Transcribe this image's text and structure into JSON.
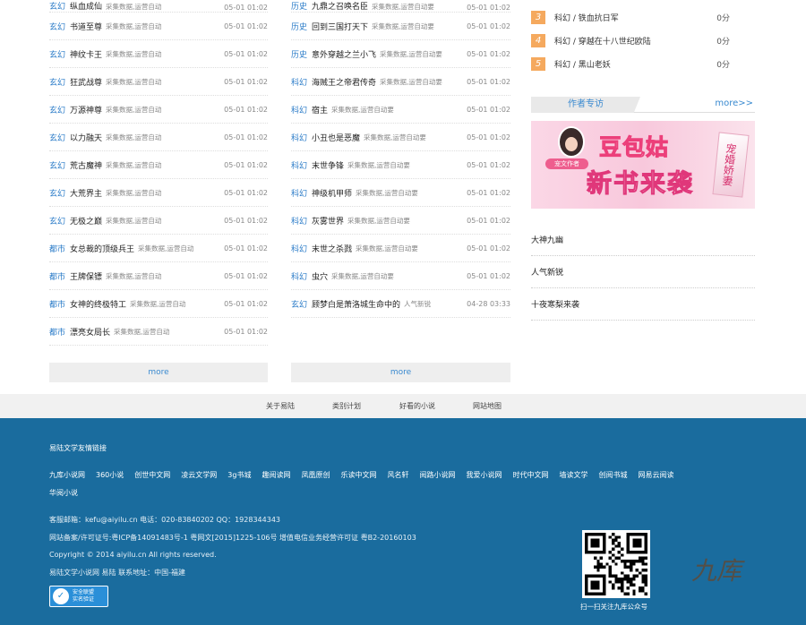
{
  "col_a": {
    "first_row": {
      "cat": "玄幻",
      "title": "纵血成仙",
      "sub": "采集数据,运营自动",
      "date": "05-01 01:02"
    },
    "rows": [
      {
        "cat": "玄幻",
        "title": "书道至尊",
        "sub": "采集数据,运营自动",
        "date": "05-01 01:02"
      },
      {
        "cat": "玄幻",
        "title": "神纹卡王",
        "sub": "采集数据,运营自动",
        "date": "05-01 01:02"
      },
      {
        "cat": "玄幻",
        "title": "狂武战尊",
        "sub": "采集数据,运营自动",
        "date": "05-01 01:02"
      },
      {
        "cat": "玄幻",
        "title": "万源神尊",
        "sub": "采集数据,运营自动",
        "date": "05-01 01:02"
      },
      {
        "cat": "玄幻",
        "title": "以力融天",
        "sub": "采集数据,运营自动",
        "date": "05-01 01:02"
      },
      {
        "cat": "玄幻",
        "title": "荒古魔神",
        "sub": "采集数据,运营自动",
        "date": "05-01 01:02"
      },
      {
        "cat": "玄幻",
        "title": "大荒界主",
        "sub": "采集数据,运营自动",
        "date": "05-01 01:02"
      },
      {
        "cat": "玄幻",
        "title": "无极之巅",
        "sub": "采集数据,运营自动",
        "date": "05-01 01:02"
      },
      {
        "cat": "都市",
        "title": "女总裁的顶级兵王",
        "sub": "采集数据,运营自动",
        "date": "05-01 01:02"
      },
      {
        "cat": "都市",
        "title": "王牌保镖",
        "sub": "采集数据,运营自动",
        "date": "05-01 01:02"
      },
      {
        "cat": "都市",
        "title": "女神的终极特工",
        "sub": "采集数据,运营自动",
        "date": "05-01 01:02"
      },
      {
        "cat": "都市",
        "title": "漂亮女局长",
        "sub": "采集数据,运营自动",
        "date": "05-01 01:02"
      }
    ],
    "more": "more"
  },
  "col_b": {
    "first_row": {
      "cat": "历史",
      "title": "九鼎之召唤名臣",
      "sub": "采集数据,运营自动要",
      "date": "05-01 01:02"
    },
    "rows": [
      {
        "cat": "历史",
        "title": "九鼎之召唤名臣",
        "sub": "采集数据,运营自动要",
        "date": "05-01 01:02"
      },
      {
        "cat": "历史",
        "title": "回到三国打天下",
        "sub": "采集数据,运营自动要",
        "date": "05-01 01:02"
      },
      {
        "cat": "历史",
        "title": "意外穿越之兰小飞",
        "sub": "采集数据,运营自动要",
        "date": "05-01 01:02"
      },
      {
        "cat": "科幻",
        "title": "海贼王之帝君传奇",
        "sub": "采集数据,运营自动要",
        "date": "05-01 01:02"
      },
      {
        "cat": "科幻",
        "title": "宿主",
        "sub": "采集数据,运营自动要",
        "date": "05-01 01:02"
      },
      {
        "cat": "科幻",
        "title": "小丑也是恶魔",
        "sub": "采集数据,运营自动要",
        "date": "05-01 01:02"
      },
      {
        "cat": "科幻",
        "title": "末世争锋",
        "sub": "采集数据,运营自动要",
        "date": "05-01 01:02"
      },
      {
        "cat": "科幻",
        "title": "神级机甲师",
        "sub": "采集数据,运营自动要",
        "date": "05-01 01:02"
      },
      {
        "cat": "科幻",
        "title": "灰雾世界",
        "sub": "采集数据,运营自动要",
        "date": "05-01 01:02"
      },
      {
        "cat": "科幻",
        "title": "末世之杀戮",
        "sub": "采集数据,运营自动要",
        "date": "05-01 01:02"
      },
      {
        "cat": "科幻",
        "title": "虫穴",
        "sub": "采集数据,运营自动要",
        "date": "05-01 01:02"
      },
      {
        "cat": "玄幻",
        "title": "顾梦白是萧洛城生命中的",
        "sub": "人气新锐",
        "date": "04-28 03:33"
      }
    ],
    "more": "more"
  },
  "rank": {
    "items": [
      {
        "num": "3",
        "title": "科幻 / 铁血抗日军",
        "score": "0分"
      },
      {
        "num": "4",
        "title": "科幻 / 穿越在十八世纪欧陆",
        "score": "0分"
      },
      {
        "num": "5",
        "title": "科幻 / 黑山老妖",
        "score": "0分"
      }
    ]
  },
  "author": {
    "title": "作者专访",
    "more": "more>>",
    "banner_line1": "豆包姑",
    "banner_line2": "新书来袭",
    "banner_tag": "宠文作者",
    "banner_book": "宠婚娇妻"
  },
  "side_list": [
    "大神九幽",
    "人气新锐",
    "十夜寒梨来袭"
  ],
  "footer_nav": [
    {
      "label": "关于易陆"
    },
    {
      "label": "类别计划"
    },
    {
      "label": "好看的小说"
    },
    {
      "label": "网站地图"
    }
  ],
  "footer": {
    "links_title": "易陆文学友情链接",
    "links": [
      "九库小说网",
      "360小说",
      "创世中文网",
      "凌云文学网",
      "3g书城",
      "趣阅读网",
      "凤凰原创",
      "乐读中文网",
      "风名轩",
      "阅路小说网",
      "我爱小说网",
      "时代中文网",
      "墙读文学",
      "创阅书城",
      "网易云阅读",
      "华阅小说"
    ],
    "contact": "客服邮箱：kefu@aiyilu.cn 电话：020-83840202 QQ：1928344343",
    "license": "网站备案/许可证号:粤ICP备14091483号-1    粤网文[2015]1225-106号    增值电信业务经营许可证 粤B2-20160103",
    "copyright": "Copyright © 2014 aiyilu.cn All rights reserved.",
    "address": "易陆文学小说网 易陆 联系地址：中国-福建",
    "badge_line1": "安全联盟",
    "badge_line2": "实名验证",
    "qr_caption": "扫一扫关注九库公众号",
    "logo_text": "九库"
  }
}
